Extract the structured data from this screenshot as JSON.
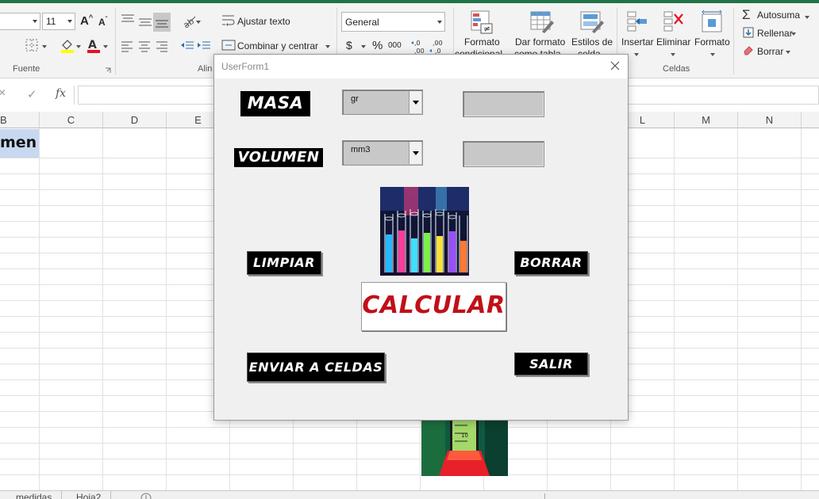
{
  "ribbon": {
    "font_size": "11",
    "wrap_text": "Ajustar texto",
    "merge_center": "Combinar y centrar",
    "number_format": "General",
    "currency_symbol": "$",
    "percent_symbol": "%",
    "thousands": "000",
    "dec_increase": ",0\n,00",
    "dec_decrease": ",00\n,0",
    "cond_format": "Formato",
    "cond_format_2": "condicional",
    "table_format": "Dar formato",
    "table_format_2": "como tabla",
    "cell_styles": "Estilos de",
    "cell_styles_2": "celda",
    "insert": "Insertar",
    "delete": "Eliminar",
    "format": "Formato",
    "autosum": "Autosuma",
    "fill": "Rellenar",
    "clear": "Borrar",
    "group_font": "Fuente",
    "group_align": "Alin",
    "group_cells": "Celdas",
    "font_color": "#e81123",
    "highlight_color": "#ffff00"
  },
  "formula_bar": {
    "fx": "fx",
    "cancel": "×",
    "enter": "✓",
    "value": ""
  },
  "grid": {
    "columns": [
      "B",
      "C",
      "D",
      "E",
      "L",
      "M",
      "N"
    ],
    "selected_cell_text": "men"
  },
  "sheets": [
    "medidas",
    "Hoja2"
  ],
  "dialog": {
    "title": "UserForm1",
    "masa_label": "MASA",
    "volumen_label": "VOLUMEN",
    "masa_unit": "gr",
    "volumen_unit": "mm3",
    "masa_value": "",
    "volumen_value": "",
    "limpiar": "LIMPIAR",
    "borrar": "BORRAR",
    "calcular": "CALCULAR",
    "enviar": "ENVIAR A CELDAS",
    "salir": "SALIR"
  },
  "colors": {
    "excel_green": "#217346",
    "selection_blue": "#c6d9f0",
    "calcular_red": "#c01018"
  }
}
